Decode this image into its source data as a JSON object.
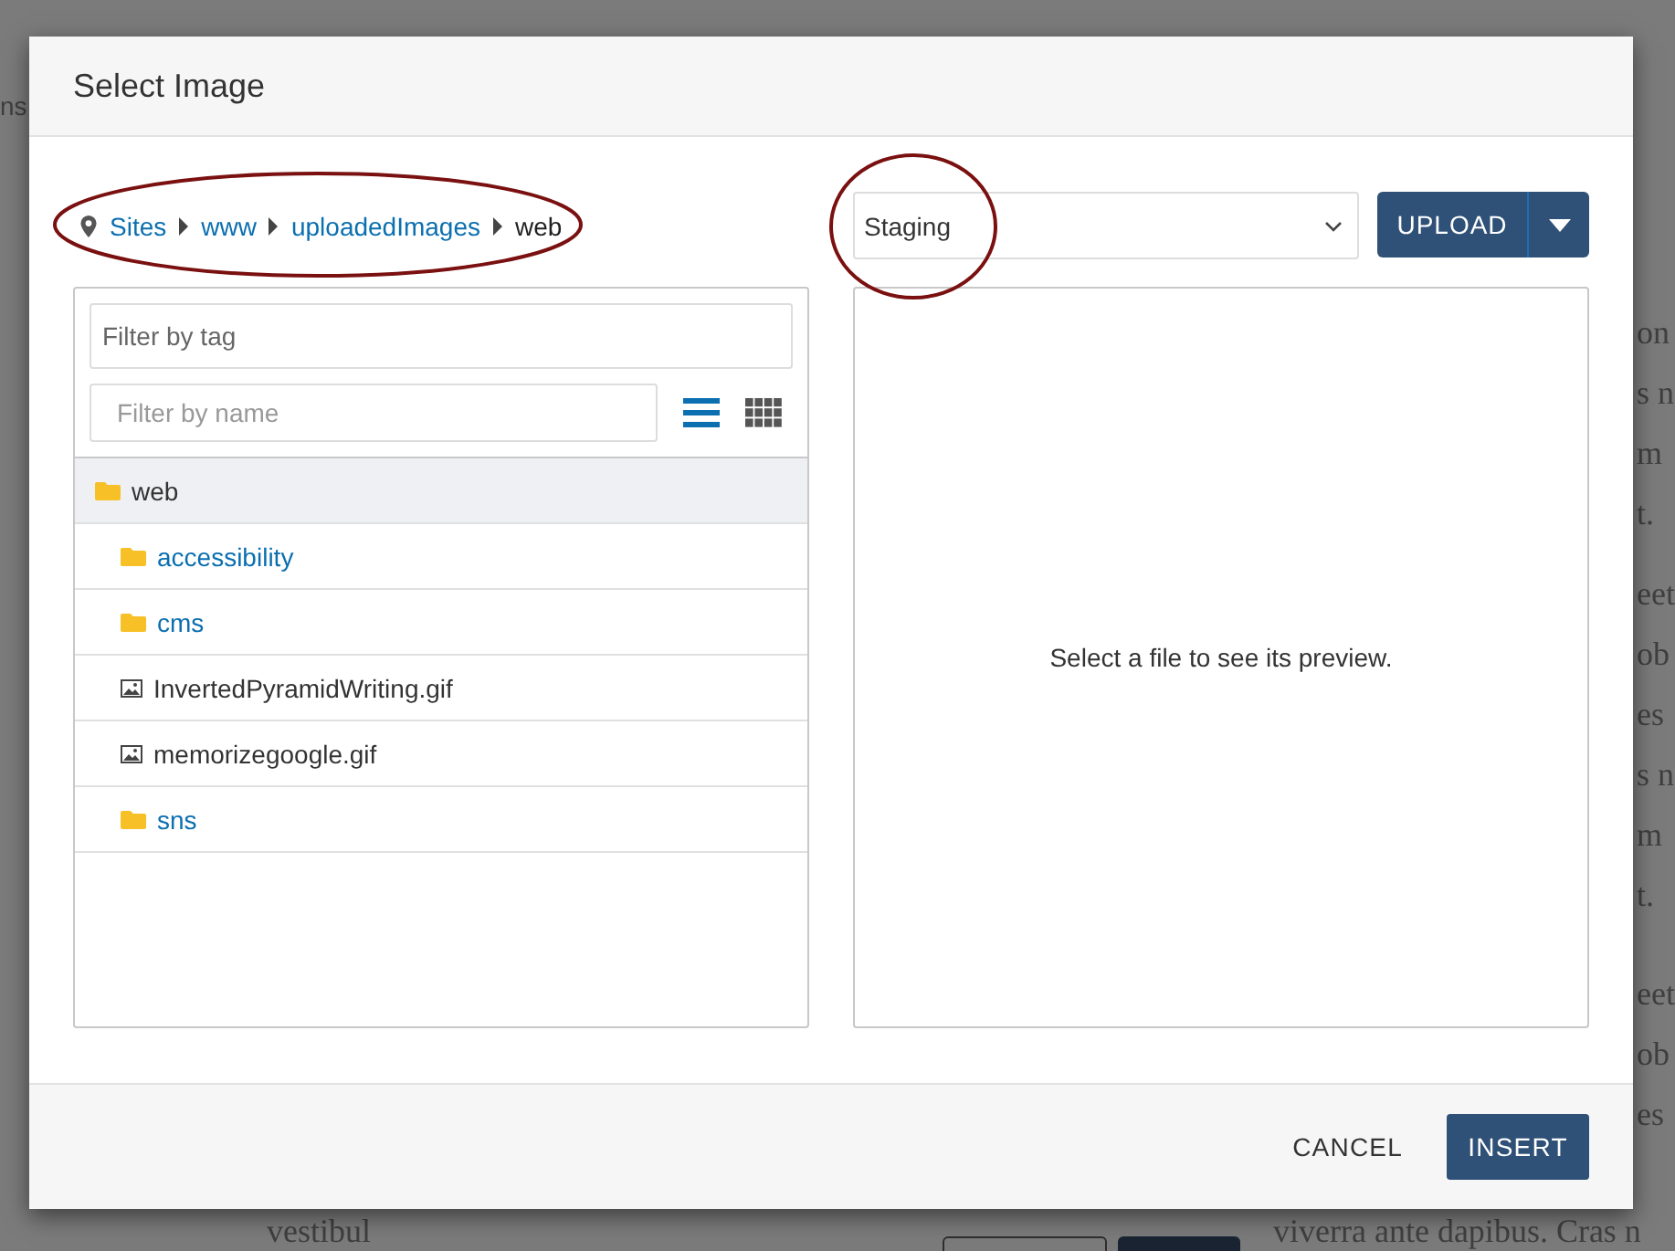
{
  "background_page": {
    "top_left": "ns",
    "right_column": [
      [
        "on",
        "s n",
        "m",
        "t."
      ],
      [
        "eet",
        "ob",
        "es",
        "s n",
        "m",
        "t."
      ],
      [
        "eet",
        "ob",
        "es"
      ]
    ],
    "bottom_left": "vestibul",
    "bottom_right": "viverra ante dapibus. Cras n"
  },
  "dialog": {
    "title": "Select Image",
    "breadcrumb": [
      {
        "label": "Sites",
        "kind": "link"
      },
      {
        "label": "www",
        "kind": "link"
      },
      {
        "label": "uploadedImages",
        "kind": "link"
      },
      {
        "label": "web",
        "kind": "current"
      }
    ],
    "tag_filter": {
      "placeholder": "Filter by tag"
    },
    "name_filter": {
      "placeholder": "Filter by name"
    },
    "view_modes": [
      {
        "kind": "list",
        "selected": true
      },
      {
        "kind": "grid",
        "selected": false
      }
    ],
    "tree": {
      "label": "web",
      "kind": "folder",
      "selected": true,
      "children": [
        {
          "label": "accessibility",
          "kind": "folder",
          "selected": false
        },
        {
          "label": "cms",
          "kind": "folder",
          "selected": false
        },
        {
          "label": "InvertedPyramidWriting.gif",
          "kind": "image",
          "selected": false
        },
        {
          "label": "memorizegoogle.gif",
          "kind": "image",
          "selected": false
        },
        {
          "label": "sns",
          "kind": "folder",
          "selected": false
        }
      ]
    },
    "environment": {
      "value": "Staging"
    },
    "upload_button": "UPLOAD",
    "preview_message": "Select a file to see its preview.",
    "buttons": [
      {
        "label": "CANCEL",
        "kind": "flat"
      },
      {
        "label": "INSERT",
        "kind": "primary"
      }
    ]
  }
}
